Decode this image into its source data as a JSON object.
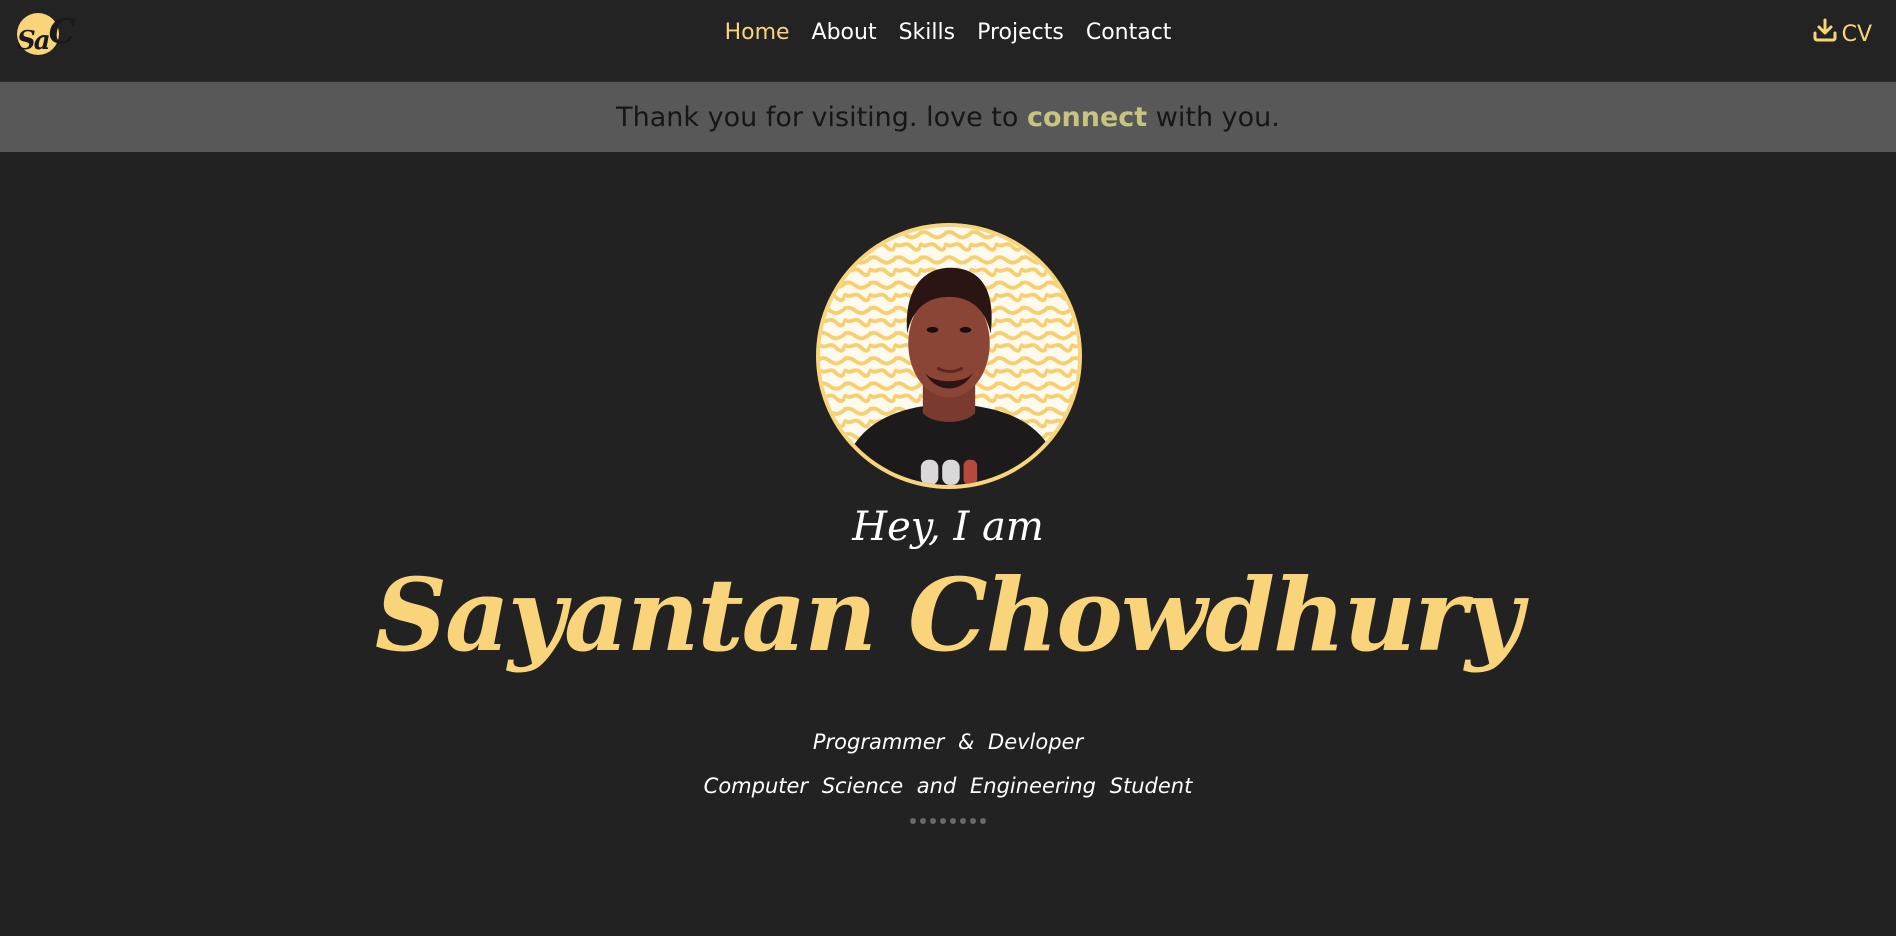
{
  "logo": {
    "text_small": "Sa",
    "text_big": "C"
  },
  "nav": {
    "items": [
      {
        "label": "Home",
        "active": true
      },
      {
        "label": "About",
        "active": false
      },
      {
        "label": "Skills",
        "active": false
      },
      {
        "label": "Projects",
        "active": false
      },
      {
        "label": "Contact",
        "active": false
      }
    ],
    "cv_label": "CV",
    "cv_icon": "download-icon"
  },
  "banner": {
    "before": "Thank you for visiting. love to ",
    "highlight": "connect",
    "after": " with you."
  },
  "hero": {
    "greeting": "Hey, I am",
    "name": "Sayantan Chowdhury",
    "role_line1": "Programmer & Devloper",
    "role_line2": "Computer Science and Engineering Student",
    "indicator_dots": 8
  },
  "colors": {
    "accent": "#f9d47a",
    "background": "#222222",
    "banner": "#585858",
    "banner_highlight": "#c7c47f"
  }
}
